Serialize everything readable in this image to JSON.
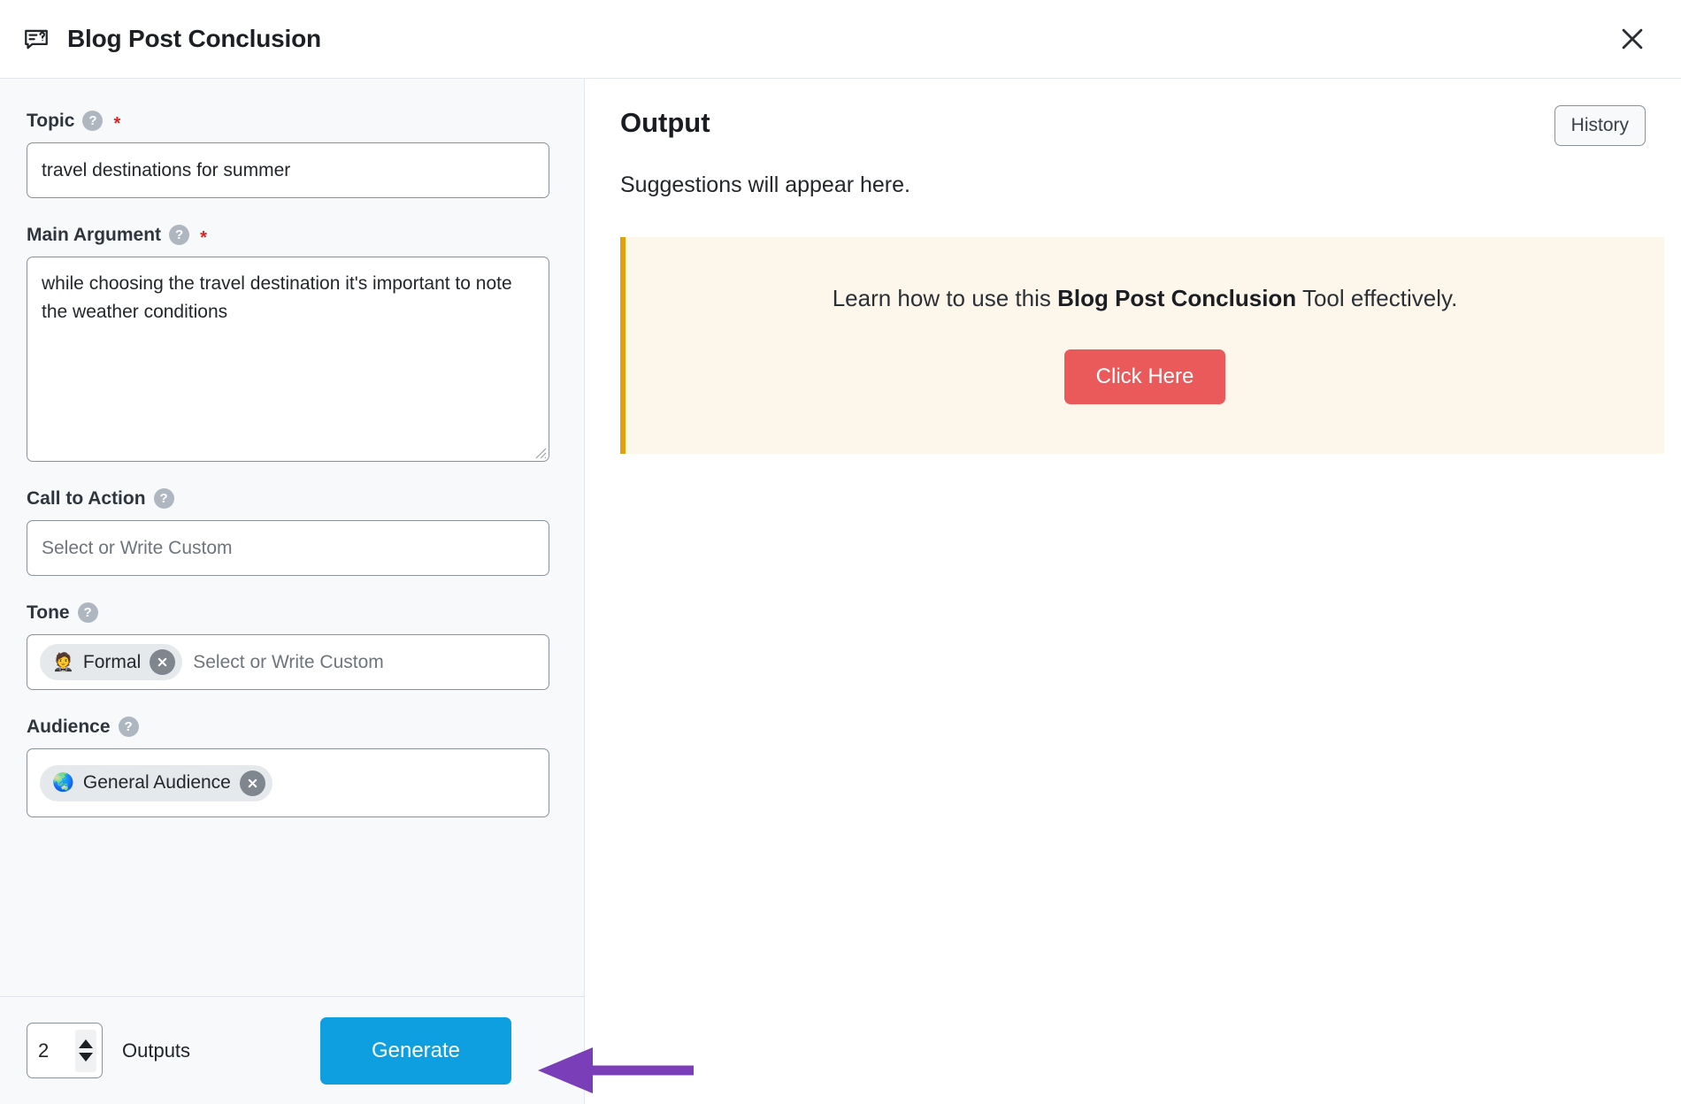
{
  "header": {
    "title": "Blog Post Conclusion",
    "icon": "speech-bubble-question-icon",
    "close_icon": "close-icon"
  },
  "form": {
    "fields": [
      {
        "id": "topic",
        "label": "Topic",
        "help_icon": "question-mark-icon",
        "required": true,
        "required_marker": "*",
        "type": "text",
        "value": "travel destinations for summer",
        "placeholder": ""
      },
      {
        "id": "main_argument",
        "label": "Main Argument",
        "help_icon": "question-mark-icon",
        "required": true,
        "required_marker": "*",
        "type": "textarea",
        "value": "while choosing the travel destination it's important to note the weather conditions",
        "placeholder": ""
      },
      {
        "id": "call_to_action",
        "label": "Call to Action",
        "help_icon": "question-mark-icon",
        "required": false,
        "type": "text",
        "value": "",
        "placeholder": "Select or Write Custom"
      },
      {
        "id": "tone",
        "label": "Tone",
        "help_icon": "question-mark-icon",
        "required": false,
        "type": "tokens",
        "placeholder": "Select or Write Custom",
        "chips": [
          {
            "emoji": "🤵",
            "label": "Formal",
            "remove_icon": "remove-chip-icon"
          }
        ]
      },
      {
        "id": "audience",
        "label": "Audience",
        "help_icon": "question-mark-icon",
        "required": false,
        "type": "tokens",
        "placeholder": "",
        "chips": [
          {
            "emoji": "🌏",
            "label": "General Audience",
            "remove_icon": "remove-chip-icon"
          }
        ]
      }
    ],
    "footer": {
      "outputs_count": "2",
      "outputs_label": "Outputs",
      "generate_label": "Generate",
      "stepper_up_icon": "chevron-up-icon",
      "stepper_down_icon": "chevron-down-icon"
    }
  },
  "output": {
    "title": "Output",
    "history_label": "History",
    "empty_text": "Suggestions will appear here.",
    "callout": {
      "text_before": "Learn how to use this ",
      "text_bold": "Blog Post Conclusion",
      "text_after": " Tool effectively.",
      "button_label": "Click Here"
    }
  },
  "annotation": {
    "arrow_icon": "left-pointing-arrow-annotation",
    "arrow_color": "#7a3fb8",
    "points_to": "Generate"
  },
  "colors": {
    "accent_blue": "#0d9fe0",
    "callout_bg": "#fdf6eb",
    "callout_border": "#e2a10b",
    "click_here_red": "#ea5a5a",
    "required_red": "#e02020",
    "panel_bg": "#f7f9fa",
    "annotation_purple": "#7a3fb8"
  }
}
